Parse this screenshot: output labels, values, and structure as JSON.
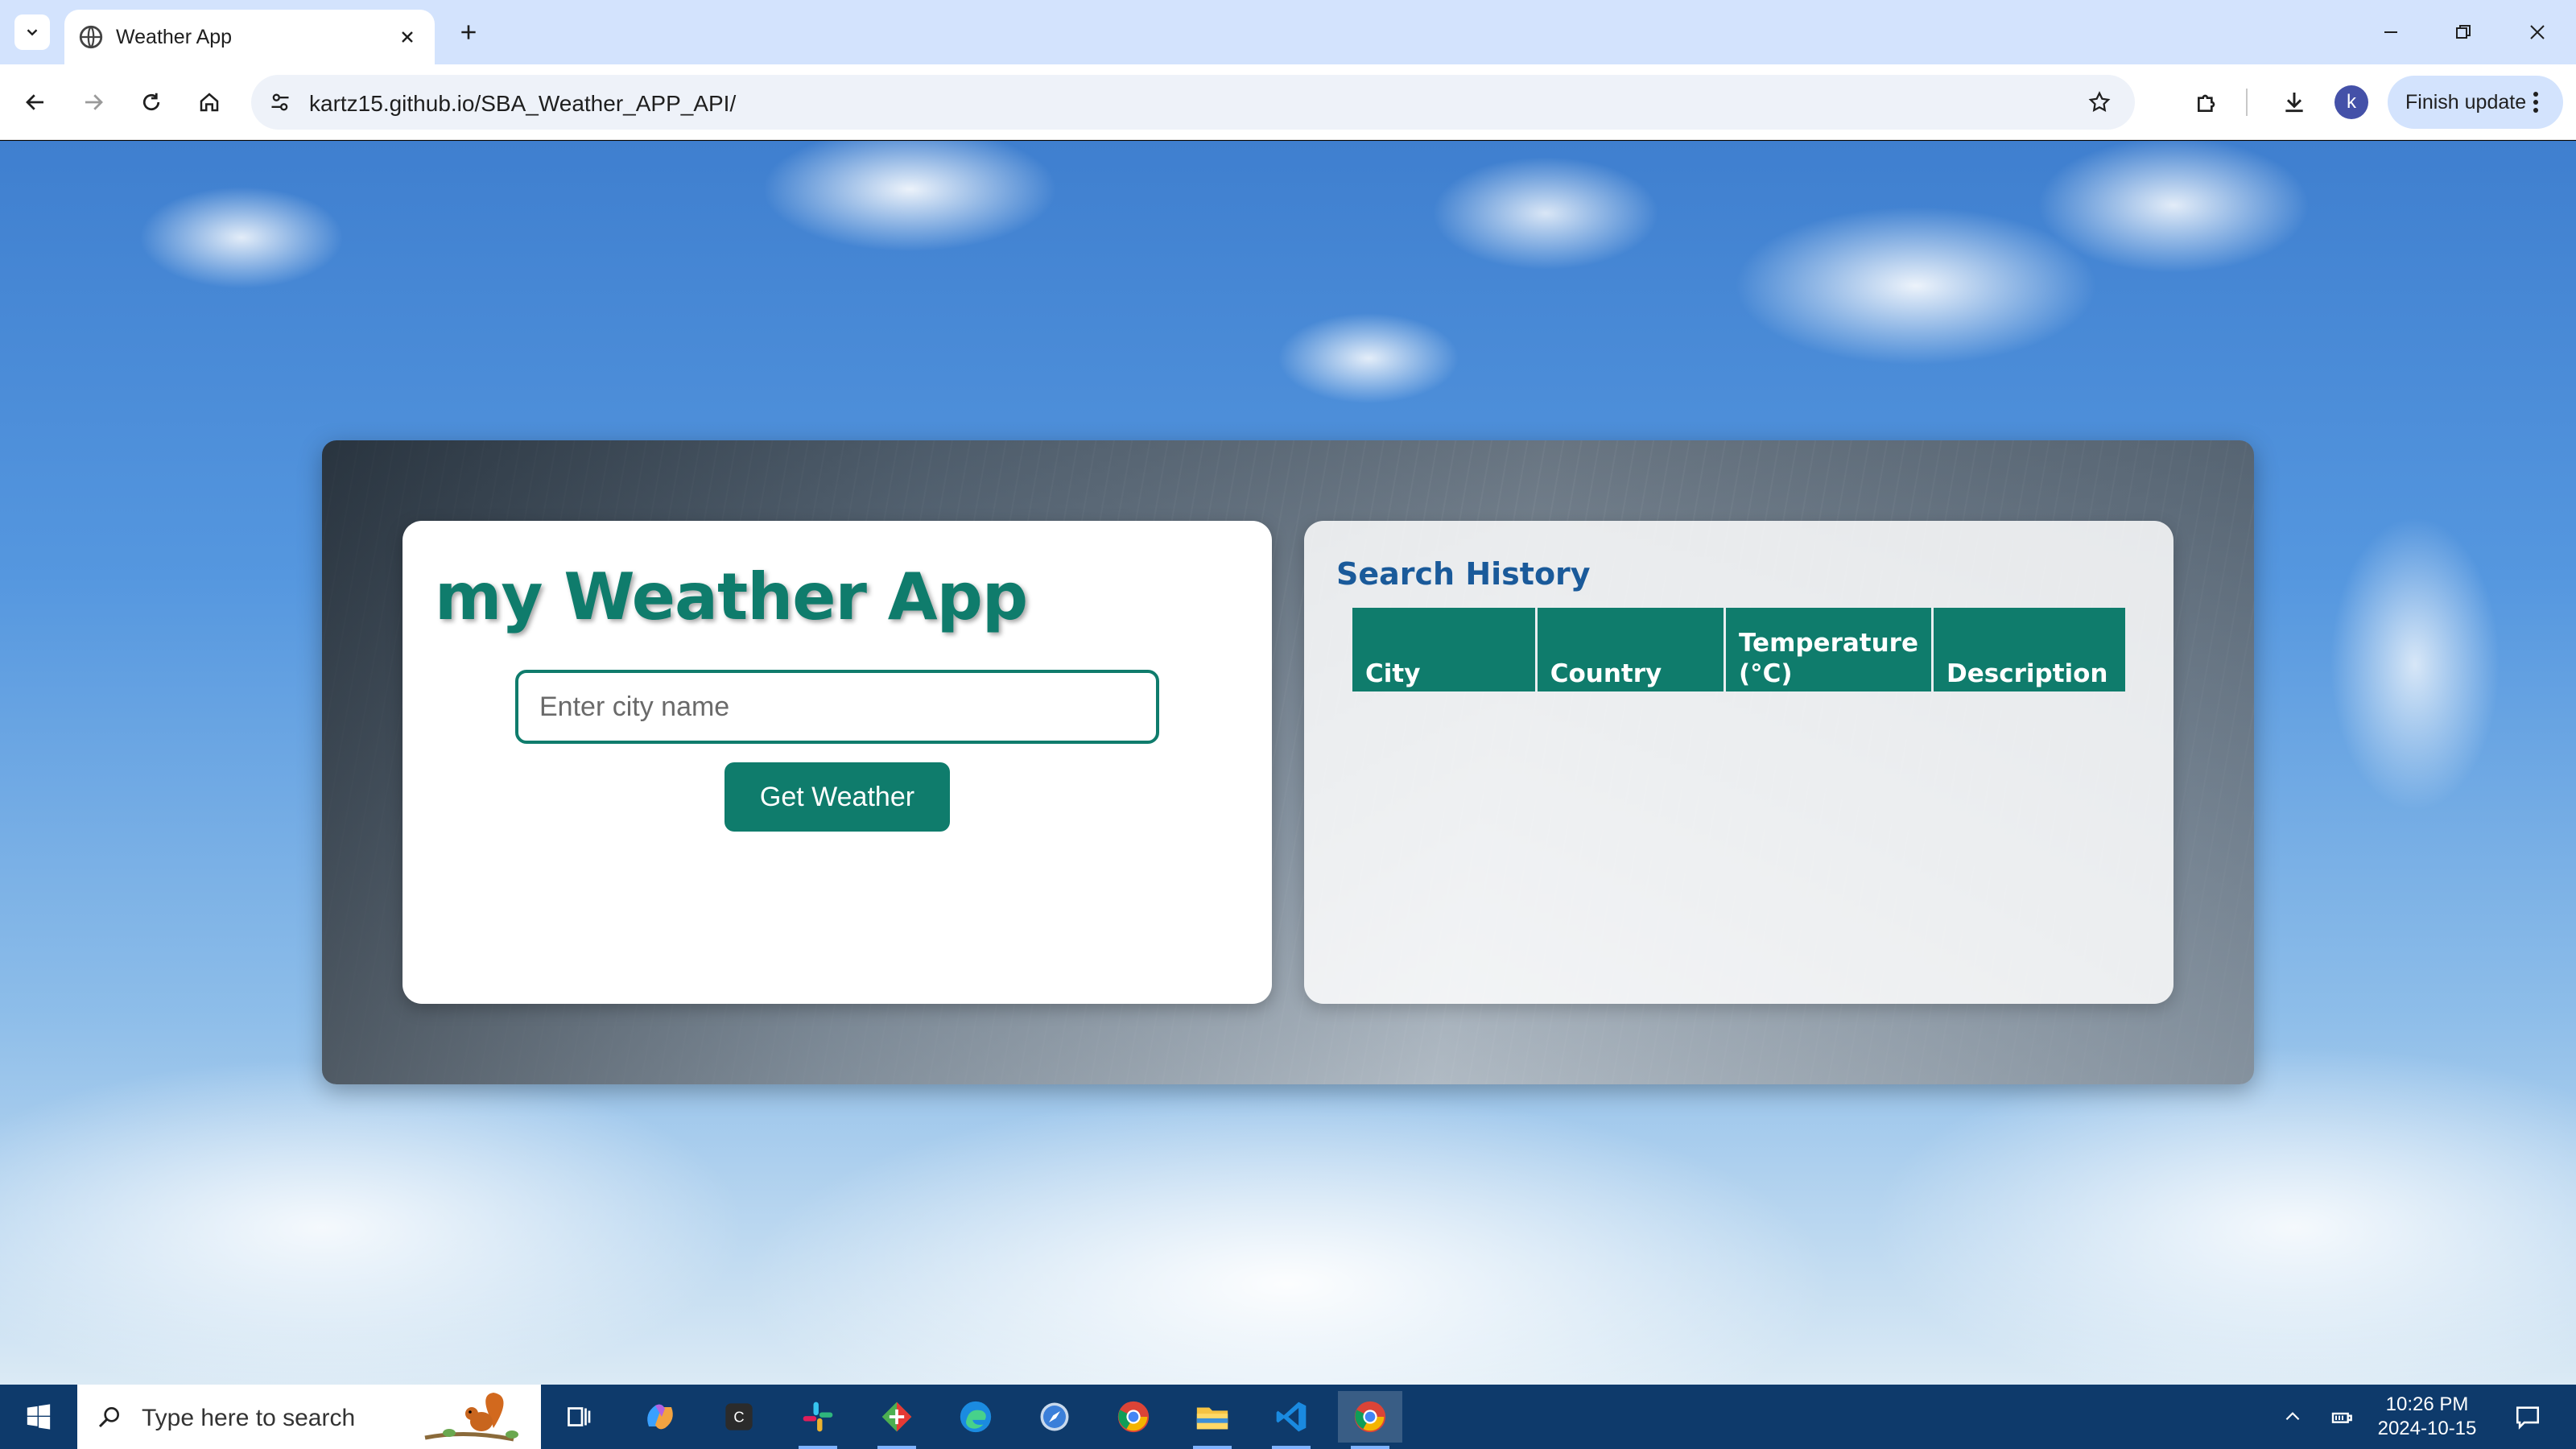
{
  "browser": {
    "tab_title": "Weather App",
    "url": "kartz15.github.io/SBA_Weather_APP_API/",
    "profile_initial": "k",
    "finish_update_label": "Finish update"
  },
  "app": {
    "title": "my Weather App",
    "city_placeholder": "Enter city name",
    "city_value": "",
    "get_weather_label": "Get Weather"
  },
  "history": {
    "title": "Search History",
    "columns": [
      "City",
      "Country",
      "Temperature (°C)",
      "Description"
    ],
    "rows": []
  },
  "taskbar": {
    "search_placeholder": "Type here to search",
    "apps": [
      "task-view",
      "copilot",
      "clipchamp",
      "slack",
      "git-client",
      "edge",
      "safari-like-compass",
      "chrome",
      "file-explorer",
      "vscode",
      "chrome-active"
    ],
    "time": "10:26 PM",
    "date": "2024-10-15"
  },
  "colors": {
    "accent": "#0f7c6c",
    "history_title": "#1a5a9a",
    "taskbar": "#0e3a6b",
    "tab_strip": "#d3e3fd"
  }
}
